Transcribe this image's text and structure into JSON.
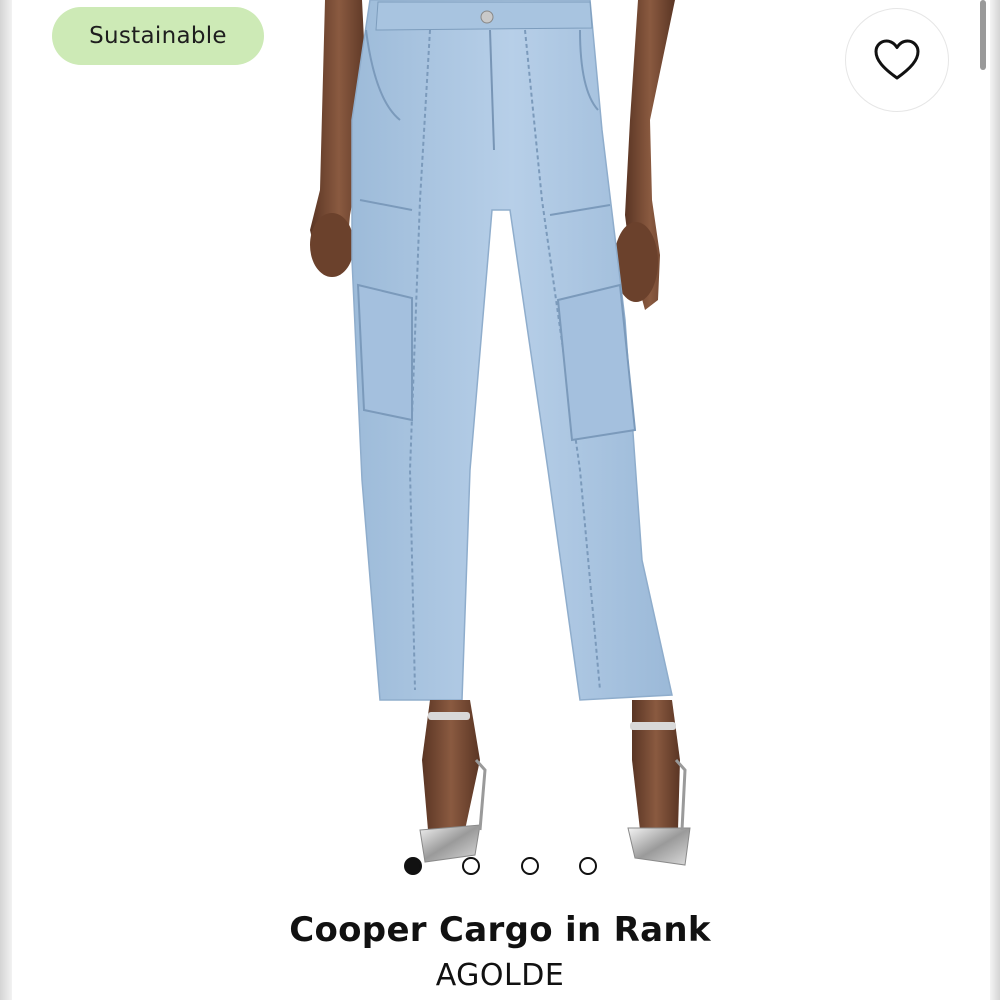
{
  "badge": {
    "label": "Sustainable"
  },
  "favorite": {
    "icon": "heart-icon"
  },
  "product": {
    "title": "Cooper Cargo in Rank",
    "brand": "AGOLDE",
    "image": "jeans-photo",
    "image_count": 4,
    "active_image_index": 0
  },
  "colors": {
    "badge_bg": "#cdeab6",
    "denim": "#a9c6e2",
    "text": "#111111"
  }
}
